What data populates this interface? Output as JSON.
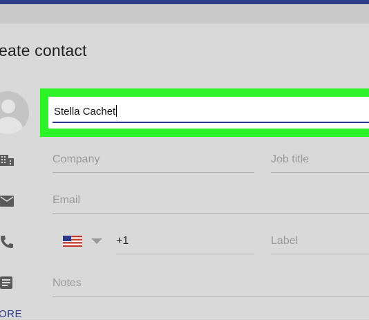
{
  "dialog": {
    "title": "eate contact"
  },
  "form": {
    "name_value": "Stella Cachet",
    "company_placeholder": "Company",
    "job_title_placeholder": "Job title",
    "email_placeholder": "Email",
    "phone_country_code": "+1",
    "phone_label_placeholder": "Label",
    "notes_placeholder": "Notes"
  },
  "footer": {
    "more_label": "ORE"
  },
  "colors": {
    "highlight": "#2ef228",
    "accent": "#2b3a8a"
  },
  "icons": {
    "avatar": "person-avatar-icon",
    "company": "building-icon",
    "email": "envelope-icon",
    "phone": "phone-icon",
    "notes": "notes-icon",
    "flag": "us-flag-icon"
  }
}
